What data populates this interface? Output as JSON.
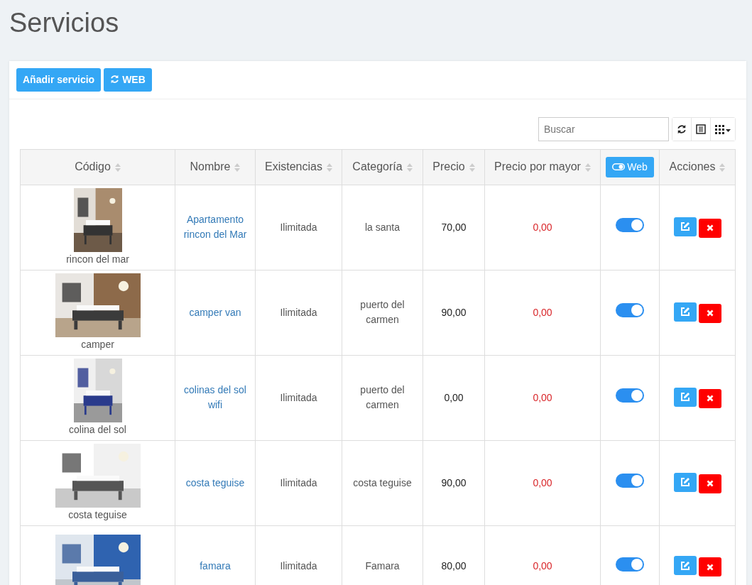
{
  "page_title": "Servicios",
  "toolbar": {
    "buttons": [
      {
        "label": "Añadir servicio",
        "kind": "text"
      },
      {
        "label": "WEB",
        "kind": "refresh"
      }
    ]
  },
  "search": {
    "placeholder": "Buscar"
  },
  "table": {
    "columns": [
      {
        "label": "Código",
        "kind": "sort"
      },
      {
        "label": "Nombre",
        "kind": "sort"
      },
      {
        "label": "Existencias",
        "kind": "sort"
      },
      {
        "label": "Categoría",
        "kind": "sort"
      },
      {
        "label": "Precio",
        "kind": "sort"
      },
      {
        "label": "Precio por mayor",
        "kind": "sort"
      },
      {
        "label": "Web",
        "kind": "toggle-button"
      },
      {
        "label": "Acciones",
        "kind": "sort"
      }
    ],
    "rows": [
      {
        "code": "rincon del mar",
        "name": "Apartamento rincon del Mar",
        "stock": "Ilimitada",
        "category": "la santa",
        "price": "70,00",
        "wholesale": "0,00",
        "web": true
      },
      {
        "code": "camper",
        "name": "camper van",
        "stock": "Ilimitada",
        "category": "puerto del carmen",
        "price": "90,00",
        "wholesale": "0,00",
        "web": true
      },
      {
        "code": "colina del sol",
        "name": "colinas del sol wifi",
        "stock": "Ilimitada",
        "category": "puerto del carmen",
        "price": "0,00",
        "wholesale": "0,00",
        "web": true
      },
      {
        "code": "costa teguise",
        "name": "costa teguise",
        "stock": "Ilimitada",
        "category": "costa teguise",
        "price": "90,00",
        "wholesale": "0,00",
        "web": true
      },
      {
        "name": "famara",
        "stock": "Ilimitada",
        "category": "Famara",
        "price": "80,00",
        "wholesale": "0,00",
        "web": true
      }
    ]
  }
}
